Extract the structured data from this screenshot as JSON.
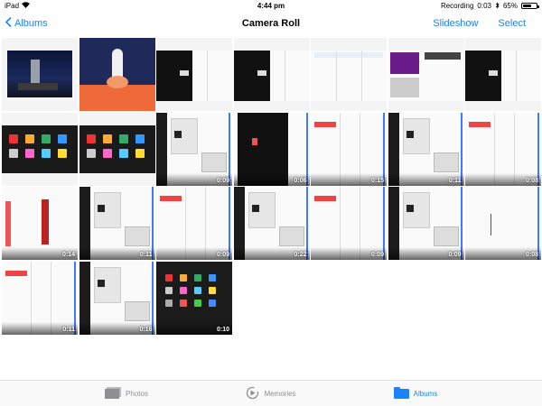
{
  "status": {
    "device": "iPad",
    "time": "4:44 pm",
    "recording": "Recording",
    "recording_time": "0:03",
    "battery": "65%",
    "battery_level": 0.65
  },
  "nav": {
    "back_label": "Albums",
    "title": "Camera Roll",
    "slideshow_label": "Slideshow",
    "select_label": "Select"
  },
  "photos": [
    {
      "kind": "launchpad",
      "duration": ""
    },
    {
      "kind": "rocket",
      "duration": ""
    },
    {
      "kind": "dark-split",
      "duration": ""
    },
    {
      "kind": "dark-split",
      "duration": ""
    },
    {
      "kind": "light-list",
      "duration": ""
    },
    {
      "kind": "purple-doc",
      "duration": ""
    },
    {
      "kind": "dark-list",
      "duration": ""
    },
    {
      "kind": "icons",
      "duration": ""
    },
    {
      "kind": "ipad-dock",
      "duration": ""
    },
    {
      "kind": "video-split",
      "duration": "0:09"
    },
    {
      "kind": "video-dark",
      "duration": "0:06"
    },
    {
      "kind": "video-light",
      "duration": "0:15"
    },
    {
      "kind": "video-split",
      "duration": "0:11"
    },
    {
      "kind": "video-light",
      "duration": "0:08"
    },
    {
      "kind": "video-red",
      "duration": "0:14"
    },
    {
      "kind": "video-split",
      "duration": "0:11"
    },
    {
      "kind": "video-light",
      "duration": "0:09"
    },
    {
      "kind": "video-split",
      "duration": "0:22"
    },
    {
      "kind": "video-light",
      "duration": "0:09"
    },
    {
      "kind": "video-split",
      "duration": "0:09"
    },
    {
      "kind": "video-plain",
      "duration": "0:08"
    },
    {
      "kind": "video-light",
      "duration": "0:11"
    },
    {
      "kind": "video-split",
      "duration": "0:16"
    },
    {
      "kind": "video-dock",
      "duration": "0:10"
    }
  ],
  "tabs": [
    {
      "label": "Photos",
      "icon": "photos-icon",
      "active": false
    },
    {
      "label": "Memories",
      "icon": "memories-icon",
      "active": false
    },
    {
      "label": "Albums",
      "icon": "albums-icon",
      "active": true
    }
  ],
  "colors": {
    "accent": "#1a82fb",
    "inactive": "#8e8e93"
  }
}
